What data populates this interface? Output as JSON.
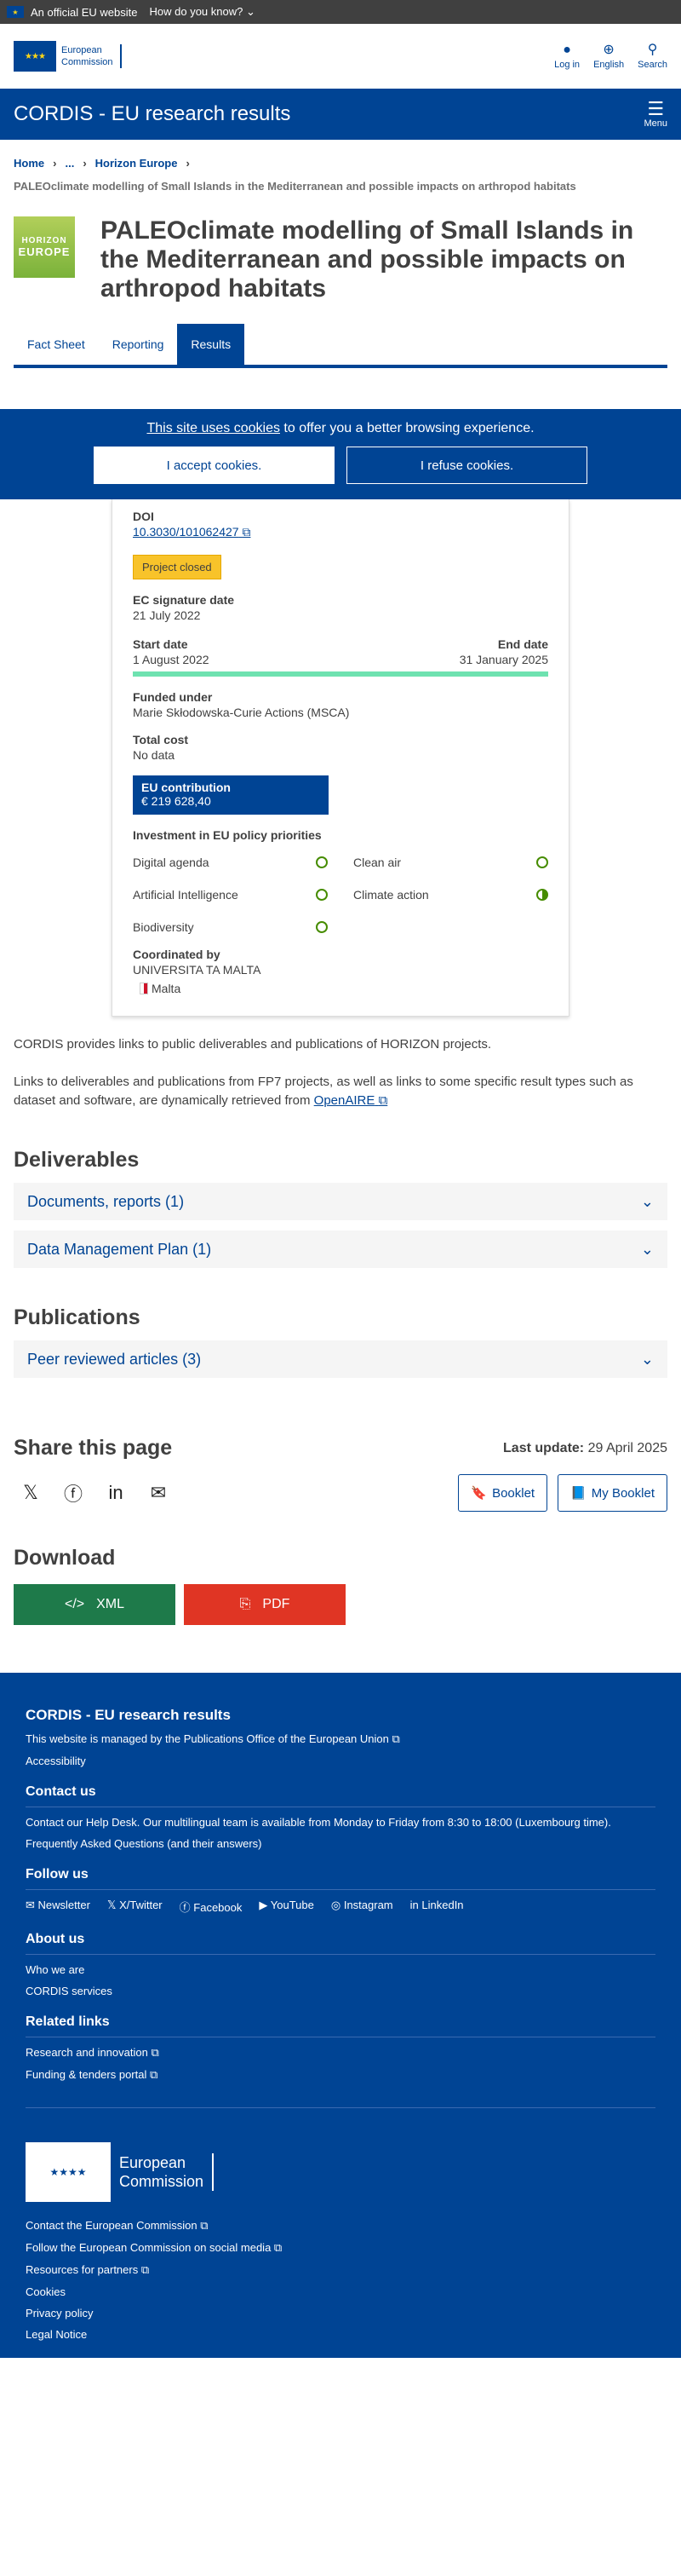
{
  "topbar": {
    "official": "An official EU website",
    "how": "How do you know?"
  },
  "header": {
    "logo_line1": "European",
    "logo_line2": "Commission",
    "login": "Log in",
    "language": "English",
    "search": "Search"
  },
  "bluebar": {
    "title": "CORDIS - EU research results",
    "menu": "Menu"
  },
  "breadcrumb": {
    "home": "Home",
    "ellipsis": "...",
    "horizon": "Horizon Europe"
  },
  "subtitle": "PALEOclimate modelling of Small Islands in the Mediterranean and possible impacts on arthropod habitats",
  "logo": {
    "line1": "HORIZON",
    "line2": "EUROPE"
  },
  "title": "PALEOclimate modelling of Small Islands in the Mediterranean and possible impacts on arthropod habitats",
  "tabs": [
    {
      "label": "Fact Sheet"
    },
    {
      "label": "Reporting"
    },
    {
      "label": "Results"
    }
  ],
  "cookie": {
    "link": "This site uses cookies",
    "text": " to offer you a better browsing experience.",
    "accept": "I accept cookies.",
    "refuse": "I refuse cookies."
  },
  "fact": {
    "doi_label": "DOI",
    "doi_value": "10.3030/101062427",
    "status": "Project closed",
    "sig_label": "EC signature date",
    "sig_value": "21 July 2022",
    "start_label": "Start date",
    "start_value": "1 August 2022",
    "end_label": "End date",
    "end_value": "31 January 2025",
    "progress": 1.0,
    "funded_label": "Funded under",
    "funded_value": "Marie Skłodowska-Curie Actions (MSCA)",
    "cost_label": "Total cost",
    "cost_value": "No data",
    "eu_label": "EU contribution",
    "eu_value": "€ 219 628,40",
    "policy_label": "Investment in EU policy priorities",
    "policies": [
      {
        "name": "Digital agenda"
      },
      {
        "name": "Clean air"
      },
      {
        "name": "Artificial Intelligence"
      },
      {
        "name": "Climate action"
      },
      {
        "name": "Biodiversity"
      }
    ],
    "coord_label": "Coordinated by",
    "coord_value": "UNIVERSITA TA MALTA",
    "country": "Malta"
  },
  "paragraphs": {
    "p1": "CORDIS provides links to public deliverables and publications of HORIZON projects.",
    "p2": "Links to deliverables and publications from FP7 projects, as well as links to some specific result types such as dataset and software, are dynamically retrieved from ",
    "openaire": "OpenAIRE"
  },
  "deliverables": {
    "title": "Deliverables",
    "items": [
      {
        "label": "Documents, reports (1)"
      },
      {
        "label": "Data Management Plan (1)"
      }
    ]
  },
  "publications": {
    "title": "Publications",
    "items": [
      {
        "label": "Peer reviewed articles (3)"
      }
    ]
  },
  "share": {
    "title": "Share this page",
    "last_update_label": "Last update:",
    "last_update_value": "29 April 2025",
    "booklet": "Booklet",
    "my_booklet": "My Booklet"
  },
  "download": {
    "title": "Download",
    "xml": "XML",
    "pdf": "PDF"
  },
  "footer": {
    "title": "CORDIS - EU research results",
    "managed_pre": "This website is managed by the ",
    "managed_link": "Publications Office of the European Union",
    "accessibility": "Accessibility",
    "contact_title": "Contact us",
    "helpdesk": "Contact our Help Desk",
    "helpdesk_text": ". Our multilingual team is available from Monday to Friday from 8:30 to 18:00 (Luxembourg time).",
    "faq": "Frequently Asked Questions",
    "faq_suffix": " (and their answers)",
    "follow_title": "Follow us",
    "follow": [
      {
        "label": "Newsletter"
      },
      {
        "label": "X/Twitter"
      },
      {
        "label": "Facebook"
      },
      {
        "label": "YouTube"
      },
      {
        "label": "Instagram"
      },
      {
        "label": "LinkedIn"
      }
    ],
    "about_title": "About us",
    "about": [
      {
        "label": "Who we are"
      },
      {
        "label": "CORDIS services"
      }
    ],
    "related_title": "Related links",
    "related": [
      {
        "label": "Research and innovation"
      },
      {
        "label": "Funding & tenders portal"
      }
    ],
    "ec_line1": "European",
    "ec_line2": "Commission",
    "ec_links": [
      {
        "label": "Contact the European Commission"
      },
      {
        "label": "Follow the European Commission on social media"
      },
      {
        "label": "Resources for partners"
      },
      {
        "label": "Cookies"
      },
      {
        "label": "Privacy policy"
      },
      {
        "label": "Legal Notice"
      }
    ]
  }
}
